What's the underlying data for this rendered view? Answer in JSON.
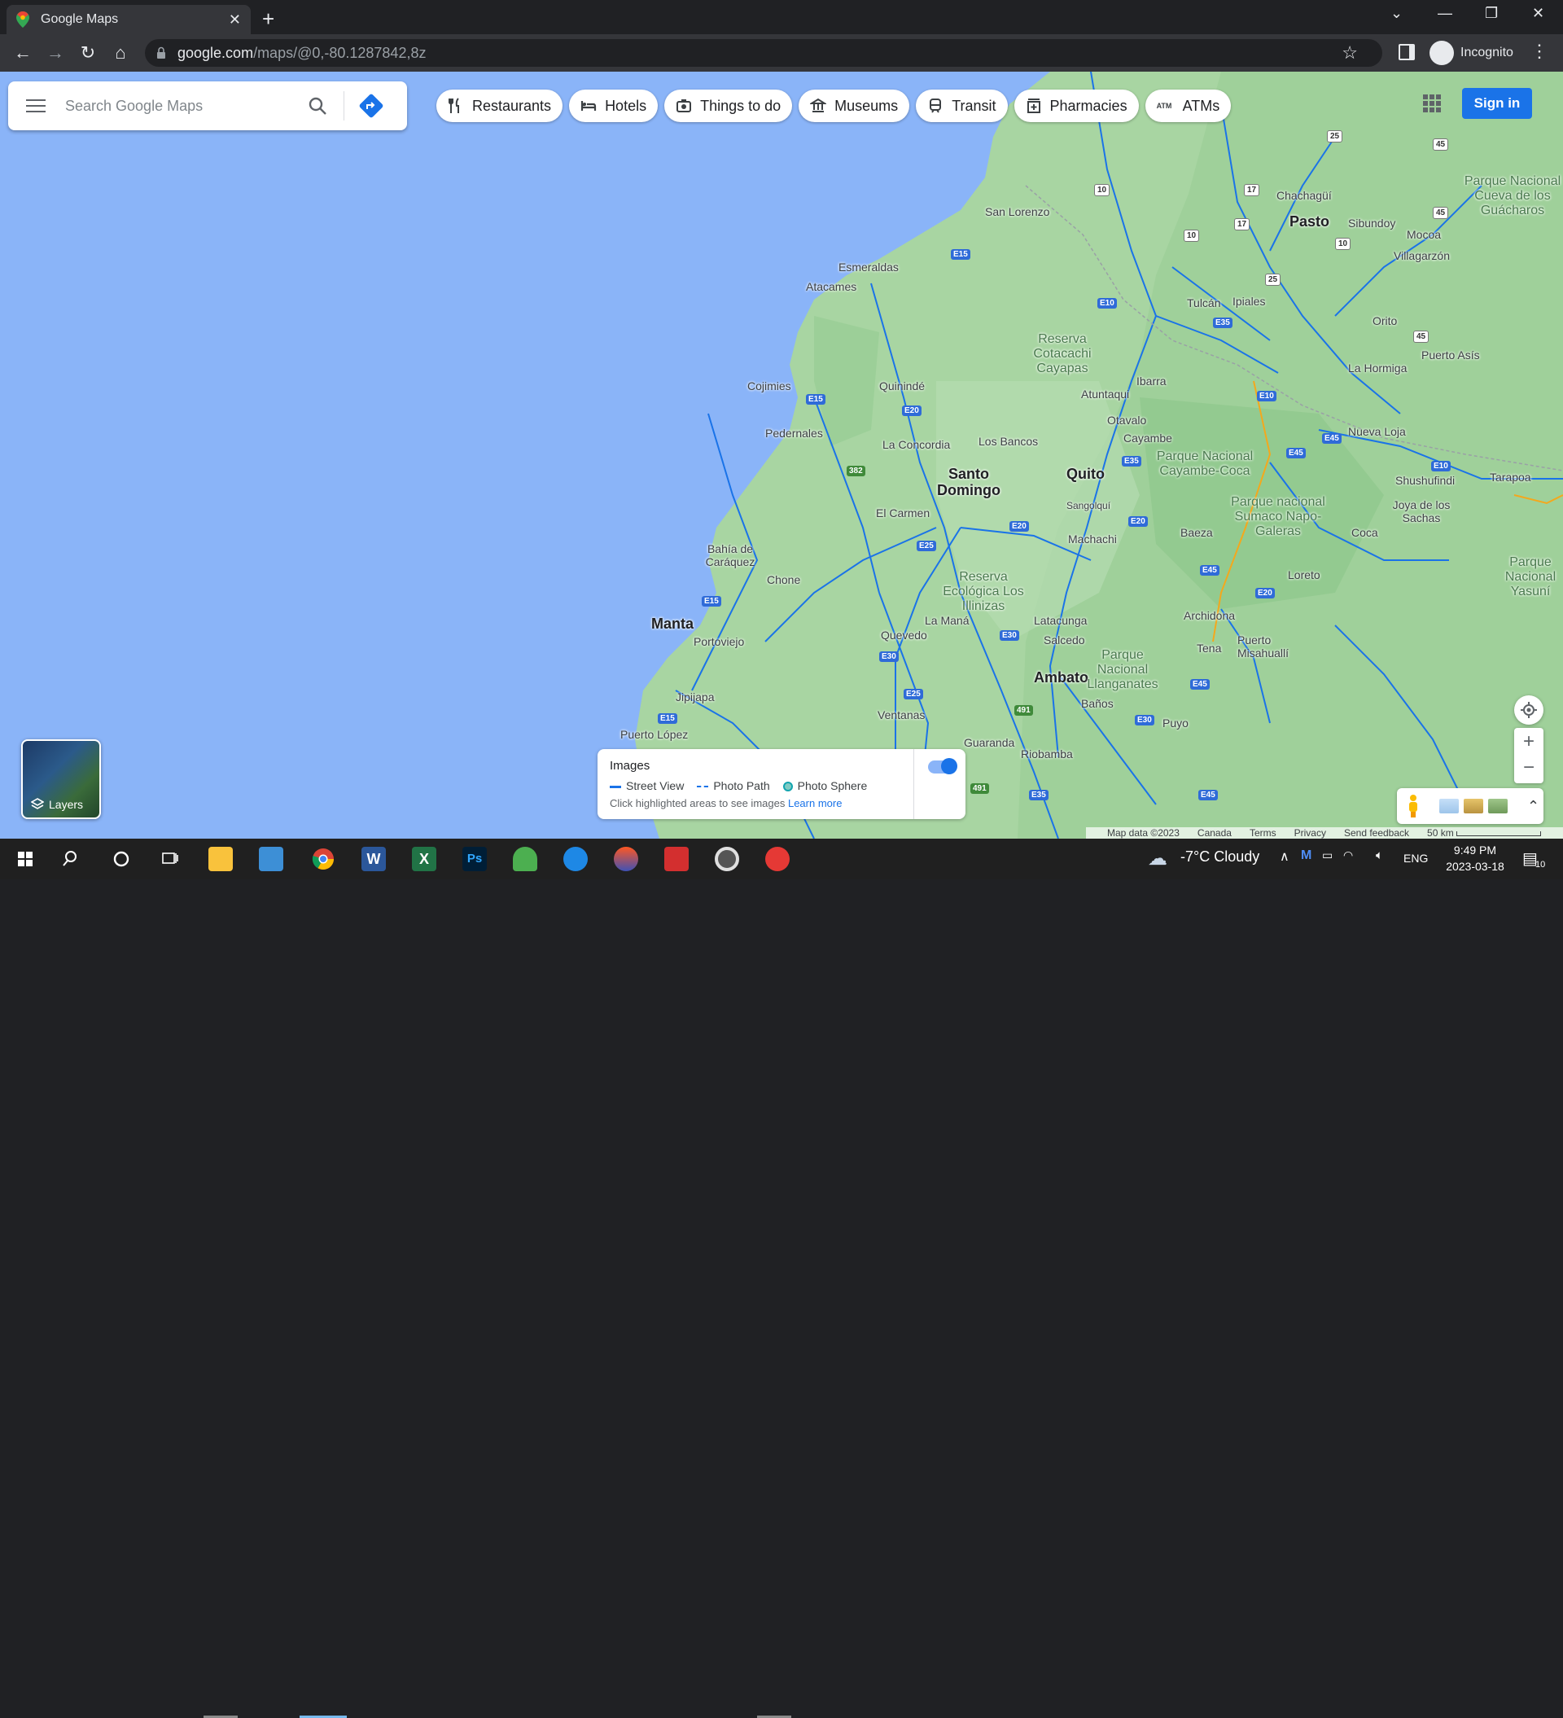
{
  "browser": {
    "tab_title": "Google Maps",
    "url_host": "google.com",
    "url_path": "/maps/@0,-80.1287842,8z",
    "profile_label": "Incognito"
  },
  "maps": {
    "search_placeholder": "Search Google Maps",
    "chips": [
      {
        "label": "Restaurants",
        "icon": "fork-knife-icon"
      },
      {
        "label": "Hotels",
        "icon": "bed-icon"
      },
      {
        "label": "Things to do",
        "icon": "camera-icon"
      },
      {
        "label": "Museums",
        "icon": "museum-icon"
      },
      {
        "label": "Transit",
        "icon": "train-icon"
      },
      {
        "label": "Pharmacies",
        "icon": "pharmacy-icon"
      },
      {
        "label": "ATMs",
        "icon": "atm-icon"
      }
    ],
    "sign_in": "Sign in",
    "layers_label": "Layers",
    "images_panel": {
      "title": "Images",
      "legend": [
        "Street View",
        "Photo Path",
        "Photo Sphere"
      ],
      "hint": "Click highlighted areas to see images",
      "learn_more": "Learn more"
    },
    "footer": {
      "map_data": "Map data ©2023",
      "region": "Canada",
      "terms": "Terms",
      "privacy": "Privacy",
      "feedback": "Send feedback",
      "scale": "50 km"
    },
    "places": {
      "quito": "Quito",
      "santo_domingo": "Santo Domingo",
      "manta": "Manta",
      "ambato": "Ambato",
      "pasto": "Pasto",
      "esmeraldas": "Esmeraldas",
      "atacames": "Atacames",
      "san_lorenzo": "San Lorenzo",
      "cojimies": "Cojimies",
      "pedernales": "Pedernales",
      "quininde": "Quinindé",
      "la_concordia": "La Concordia",
      "los_bancos": "Los Bancos",
      "el_carmen": "El Carmen",
      "bahia": "Bahía de Caráquez",
      "chone": "Chone",
      "portoviejo": "Portoviejo",
      "jipijapa": "Jipijapa",
      "puerto_lopez": "Puerto López",
      "quevedo": "Quevedo",
      "la_mana": "La Maná",
      "ventanas": "Ventanas",
      "latacunga": "Latacunga",
      "salcedo": "Salcedo",
      "banos": "Baños",
      "guaranda": "Guaranda",
      "riobamba": "Riobamba",
      "puyo": "Puyo",
      "tena": "Tena",
      "archidona": "Archidona",
      "puerto_misahualli": "Puerto Misahuallí",
      "baeza": "Baeza",
      "machachi": "Machachi",
      "sangolqui": "Sangolquí",
      "cayambe": "Cayambe",
      "otavalo": "Otavalo",
      "ibarra": "Ibarra",
      "atuntaqui": "Atuntaqui",
      "tulcan": "Tulcán",
      "ipiales": "Ipiales",
      "chachagui": "Chachagüí",
      "sibundoy": "Sibundoy",
      "mocoa": "Mocoa",
      "villagarzon": "Villagarzón",
      "orito": "Orito",
      "puerto_asis": "Puerto Asís",
      "la_hormiga": "La Hormiga",
      "nueva_loja": "Nueva Loja",
      "shushufindi": "Shushufindi",
      "tarapoa": "Tarapoa",
      "joya": "Joya de los Sachas",
      "coca": "Coca",
      "loreto": "Loreto",
      "park_cotacachi": "Reserva Cotacachi Cayapas",
      "park_cayambe": "Parque Nacional Cayambe-Coca",
      "park_sumaco": "Parque nacional Sumaco Napo-Galeras",
      "park_illinizas": "Reserva Ecológica Los Illinizas",
      "park_llanganates": "Parque Nacional Llanganates",
      "park_guacharos": "Parque Nacional Cueva de los Guácharos",
      "park_yasuni": "Parque Nacional Yasuní"
    }
  },
  "taskbar": {
    "weather": "-7°C  Cloudy",
    "lang": "ENG",
    "time": "9:49 PM",
    "date": "2023-03-18",
    "notif_count": "10"
  },
  "colors": {
    "water": "#8ab4f8",
    "land": "#a8d5a2",
    "road": "#1a73e8",
    "accent": "#1a73e8"
  }
}
